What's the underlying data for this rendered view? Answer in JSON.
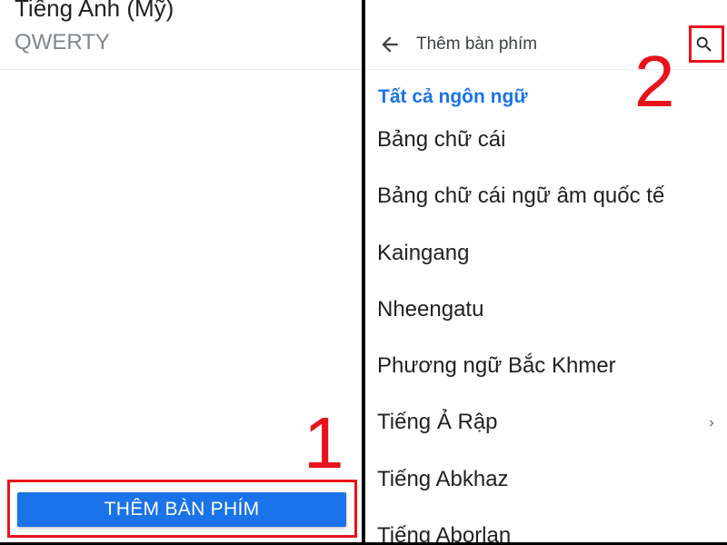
{
  "left_panel": {
    "language_name": "Tiếng Anh (Mỹ)",
    "layout_name": "QWERTY",
    "add_keyboard_button": "THÊM BÀN PHÍM"
  },
  "right_panel": {
    "title": "Thêm bàn phím",
    "section_header": "Tất cả ngôn ngữ",
    "languages": [
      {
        "label": "Bảng chữ cái",
        "has_submenu": false
      },
      {
        "label": "Bảng chữ cái ngữ âm quốc tế",
        "has_submenu": false
      },
      {
        "label": "Kaingang",
        "has_submenu": false
      },
      {
        "label": "Nheengatu",
        "has_submenu": false
      },
      {
        "label": "Phương ngữ Bắc Khmer",
        "has_submenu": false
      },
      {
        "label": "Tiếng Ả Rập",
        "has_submenu": true
      },
      {
        "label": "Tiếng Abkhaz",
        "has_submenu": false
      },
      {
        "label": "Tiếng Aborlan",
        "has_submenu": false
      }
    ]
  },
  "annotations": {
    "step1": "1",
    "step2": "2"
  },
  "icons": {
    "back": "arrow-back-icon",
    "search": "search-icon",
    "chevron": "chevron-right-icon"
  },
  "colors": {
    "accent": "#1a73e8",
    "annotation": "#e8121b",
    "divider_bar": "#000000"
  }
}
